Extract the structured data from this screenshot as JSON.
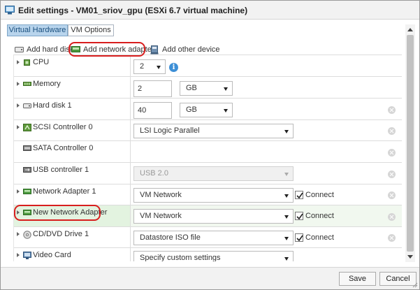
{
  "window": {
    "title": "Edit settings - VM01_sriov_gpu (ESXi 6.7 virtual machine)"
  },
  "tabs": [
    {
      "label": "Virtual Hardware",
      "active": true
    },
    {
      "label": "VM Options",
      "active": false
    }
  ],
  "toolbar": {
    "add_hard_disk": "Add hard disk",
    "add_network_adapter": "Add network adapter",
    "add_other_device": "Add other device"
  },
  "devices": [
    {
      "label": "CPU",
      "icon": "cpu-icon",
      "expandable": true,
      "value": "2"
    },
    {
      "label": "Memory",
      "icon": "memory-icon",
      "expandable": true,
      "value": "2",
      "unit": "GB"
    },
    {
      "label": "Hard disk 1",
      "icon": "hard-disk-icon",
      "expandable": true,
      "value": "40",
      "unit": "GB"
    },
    {
      "label": "SCSI Controller 0",
      "icon": "scsi-controller-icon",
      "expandable": true,
      "value": "LSI Logic Parallel"
    },
    {
      "label": "SATA Controller 0",
      "icon": "sata-controller-icon",
      "expandable": false
    },
    {
      "label": "USB controller 1",
      "icon": "usb-controller-icon",
      "expandable": false,
      "value": "USB 2.0",
      "disabled": true
    },
    {
      "label": "Network Adapter 1",
      "icon": "network-adapter-icon",
      "expandable": true,
      "value": "VM Network",
      "connect_label": "Connect",
      "connected": true
    },
    {
      "label": "New Network Adapter",
      "icon": "network-adapter-icon",
      "expandable": true,
      "value": "VM Network",
      "connect_label": "Connect",
      "connected": true,
      "highlighted": true
    },
    {
      "label": "CD/DVD Drive 1",
      "icon": "cd-dvd-icon",
      "expandable": true,
      "value": "Datastore ISO file",
      "connect_label": "Connect",
      "connected": true
    },
    {
      "label": "Video Card",
      "icon": "video-card-icon",
      "expandable": true,
      "value": "Specify custom settings"
    }
  ],
  "footer": {
    "save_label": "Save",
    "cancel_label": "Cancel"
  },
  "colors": {
    "highlight_outline": "#d81e1e",
    "active_tab": "#b8d4ec",
    "new_row_background": "#e3f3e0",
    "info": "#3d8fd6"
  }
}
